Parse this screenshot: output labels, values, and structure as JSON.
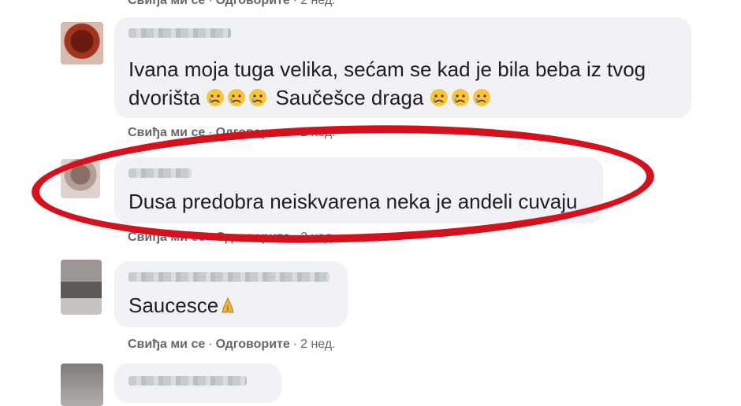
{
  "actions": {
    "like": "Свиђа ми се",
    "reply": "Одговорите",
    "time": "2 нед."
  },
  "comments": [
    {
      "text": "Ivana moja tuga velika, sećam se kad je bila beba iz tvog dvorišta",
      "text2": "Saučešce draga"
    },
    {
      "text": "Dusa predobra neiskvarena neka je andeli cuvaju"
    },
    {
      "text": "Saucesce"
    }
  ],
  "colors": {
    "circle": "#d6101c",
    "bubble": "#f0f2f5",
    "meta": "#65676b"
  },
  "icons": [
    "crying-face-icon",
    "folded-hands-icon"
  ]
}
